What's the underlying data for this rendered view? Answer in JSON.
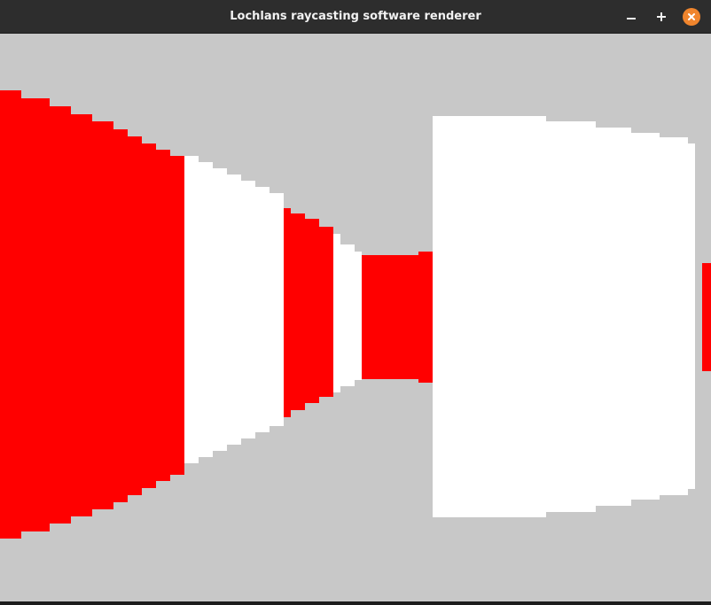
{
  "window": {
    "title": "Lochlans raycasting software renderer",
    "controls": [
      {
        "name": "minimize",
        "icon": "minimize-icon"
      },
      {
        "name": "maximize",
        "icon": "plus-icon"
      },
      {
        "name": "close",
        "icon": "close-icon"
      }
    ]
  },
  "colors": {
    "titlebar": "#2d2d2d",
    "title_text": "#f2f2f2",
    "close_button": "#f0852d",
    "background": "#c8c8c8",
    "wall_red": "#ff0000",
    "wall_white": "#ffffff"
  }
}
